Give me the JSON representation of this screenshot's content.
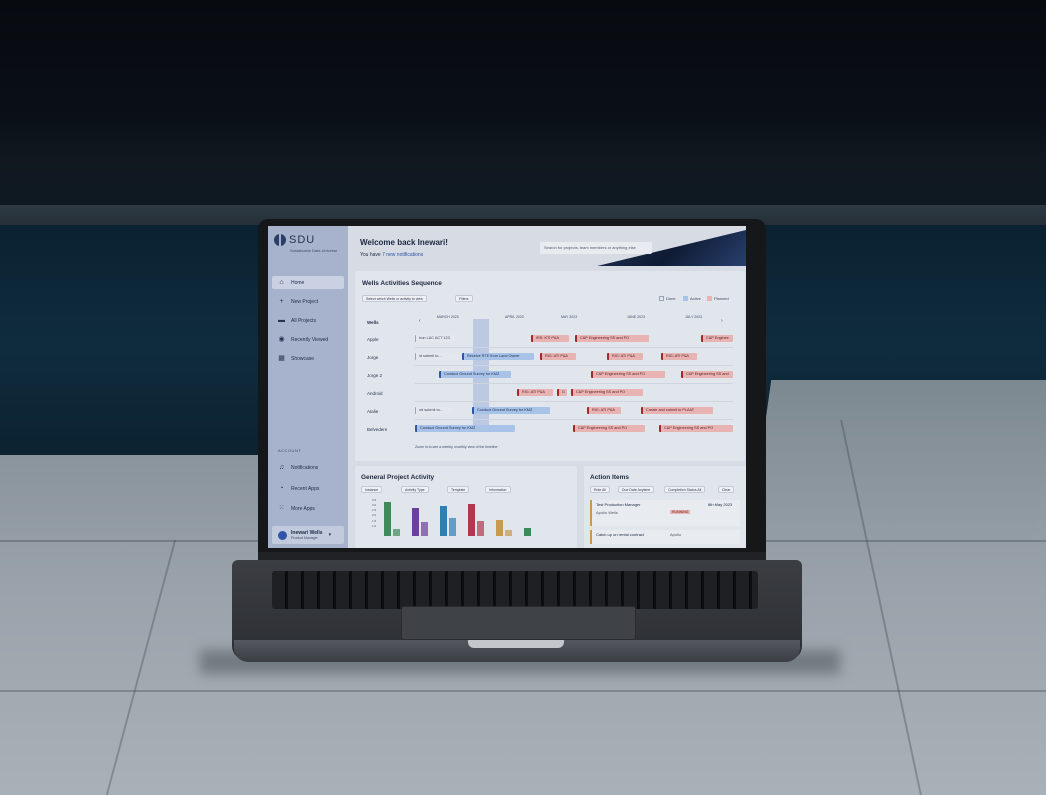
{
  "app": {
    "brand": "SDU",
    "tagline": "Sustainable Data Universe"
  },
  "sidebar": {
    "items": [
      {
        "label": "Home",
        "icon": "home-icon"
      },
      {
        "label": "New Project",
        "icon": "plus-icon"
      },
      {
        "label": "All Projects",
        "icon": "folder-icon"
      },
      {
        "label": "Recently Viewed",
        "icon": "eye-icon"
      },
      {
        "label": "Showcase",
        "icon": "grid-icon"
      }
    ],
    "section_label": "ACCOUNT",
    "account_items": [
      {
        "label": "Notifications",
        "icon": "bell-icon"
      },
      {
        "label": "Recent Apps",
        "icon": "clock-icon"
      },
      {
        "label": "More Apps",
        "icon": "apps-icon"
      }
    ],
    "user": {
      "name": "Inewari Wells",
      "role": "Product Manager"
    }
  },
  "header": {
    "welcome": "Welcome back Inewari!",
    "notif_prefix": "You have ",
    "notif_link": "7 new notifications",
    "search_placeholder": "Search for projects, team members or anything else"
  },
  "sequence": {
    "title": "Wells Activities Sequence",
    "filter_select": "Select which Wells or activity to view",
    "filters_label": "Filters",
    "legend": [
      {
        "label": "Done",
        "color": "#e4e7ed"
      },
      {
        "label": "Active",
        "color": "#a8c2e8"
      },
      {
        "label": "Planned",
        "color": "#e8b3b3"
      }
    ],
    "months": [
      "MARCH 2023",
      "APRIL 2023",
      "MAY 2023",
      "JUNE 2023",
      "JULY 2023"
    ],
    "wells_header": "Wells",
    "rows": [
      {
        "label": "Apple",
        "bars": [
          {
            "text": "Iron L&C  ACT 123",
            "type": "grey"
          },
          {
            "text": "IRS: KTI P&A",
            "type": "red"
          },
          {
            "text": "C&P Engineering SS and PO",
            "type": "red"
          },
          {
            "text": "C&P Enginee",
            "type": "red"
          }
        ]
      },
      {
        "label": "Jorge",
        "bars": [
          {
            "text": "id submit to...",
            "type": "grey"
          },
          {
            "text": "Receive RTE from Land Owner",
            "type": "blue"
          },
          {
            "text": "RIG: ATI P&A",
            "type": "red"
          },
          {
            "text": "RIG: ATI P&A",
            "type": "red"
          },
          {
            "text": "RIG: ATI P&A",
            "type": "red"
          }
        ]
      },
      {
        "label": "Jorge 2",
        "bars": [
          {
            "text": "Conduct Ground Survey for KMZ",
            "type": "blue"
          },
          {
            "text": "C&P Engineering SS and PO",
            "type": "red"
          },
          {
            "text": "C&P Engineering SS and",
            "type": "red"
          }
        ]
      },
      {
        "label": "Android",
        "bars": [
          {
            "text": "RIG: ATI P&A",
            "type": "red"
          },
          {
            "text": "G",
            "type": "red"
          },
          {
            "text": "C&P Engineering SS and PO",
            "type": "red"
          }
        ]
      },
      {
        "label": "Atalie",
        "bars": [
          {
            "text": "nd submit to...",
            "type": "grey"
          },
          {
            "text": "Conduct Ground Survey for KMZ",
            "type": "blue"
          },
          {
            "text": "RIG: ATI P&A",
            "type": "red"
          },
          {
            "text": "Create and submit to PLAAT",
            "type": "red"
          }
        ]
      },
      {
        "label": "Belvedere",
        "bars": [
          {
            "text": "Conduct Ground Survey for KMZ",
            "type": "blue"
          },
          {
            "text": "C&P Engineering SS and PO",
            "type": "red"
          },
          {
            "text": "C&P Engineering SS and PO",
            "type": "red"
          }
        ]
      }
    ],
    "footnote": "Zoom in to see a weekly, monthly view of the timeline"
  },
  "activity": {
    "title": "General Project Activity",
    "filters": [
      "Instance",
      "Activity Type",
      "Template",
      "Information"
    ],
    "chart_data": {
      "type": "bar",
      "categories": [
        "1",
        "2",
        "3",
        "4",
        "5",
        "6"
      ],
      "series": [
        {
          "values": [
            3.3,
            0.7
          ]
        },
        {
          "values": [
            2.7,
            1.4
          ]
        },
        {
          "values": [
            2.9,
            1.8
          ]
        },
        {
          "values": [
            3.1,
            1.5
          ]
        },
        {
          "values": [
            1.6,
            0.6
          ]
        },
        {
          "values": [
            0.8
          ]
        }
      ],
      "colors": [
        "#3f8a5a",
        "#6c3f9c",
        "#2f7fb4",
        "#b3364f",
        "#c79a4e"
      ],
      "yticks": [
        "3.5",
        "3.0",
        "2.5",
        "2.0",
        "1.5",
        "1.0"
      ],
      "ylim": [
        0,
        3.5
      ]
    }
  },
  "actions": {
    "title": "Action Items",
    "filters": [
      "Role All",
      "Due Date Anytime",
      "Completion Status All",
      "Clear"
    ],
    "items": [
      {
        "title": "Test Production Manager",
        "sub": "Apollo Wells",
        "status": "RUNNING",
        "date": "8th May 2023"
      },
      {
        "title": "Catch up on rental contract",
        "sub": "Apollo",
        "status": "",
        "date": ""
      }
    ]
  }
}
